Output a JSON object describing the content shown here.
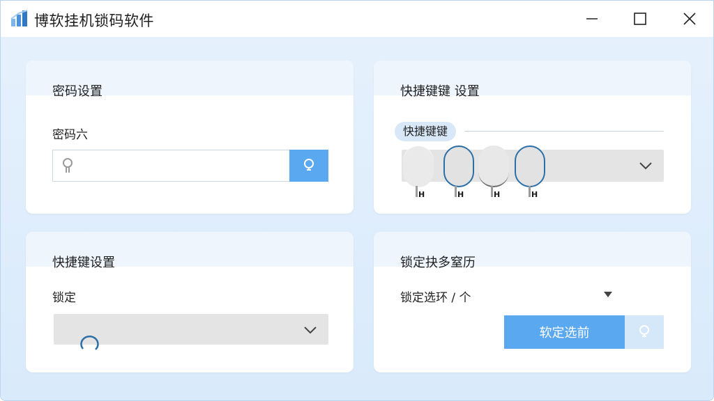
{
  "window": {
    "title": "博软挂机锁码软件"
  },
  "password_card": {
    "title": "密码设置",
    "field_label": "密码六",
    "input_value": ""
  },
  "hotkey_combo_card": {
    "title": "快捷键键 设置",
    "chip_label": "快捷键键",
    "key_labels": [
      "H",
      "H",
      "H",
      "H"
    ]
  },
  "shortcut_card": {
    "title": "快捷键设置",
    "field_label": "锁定"
  },
  "lock_card": {
    "title": "锁定抉多窒历",
    "select_value": "锁定选环 / 个",
    "button_label": "软定选前"
  },
  "icons": {
    "app_logo": "bar-chart-logo-icon",
    "minimize": "minimize-icon",
    "maximize": "maximize-icon",
    "close": "close-icon",
    "password_key": "key-icon",
    "password_button": "lightbulb-icon",
    "lock_aux": "lightbulb-icon"
  },
  "colors": {
    "accent": "#5aa8ef",
    "accent_light": "#d4e8fa",
    "window_bg": "#dfedfb",
    "ring": "#2c6ea6"
  }
}
